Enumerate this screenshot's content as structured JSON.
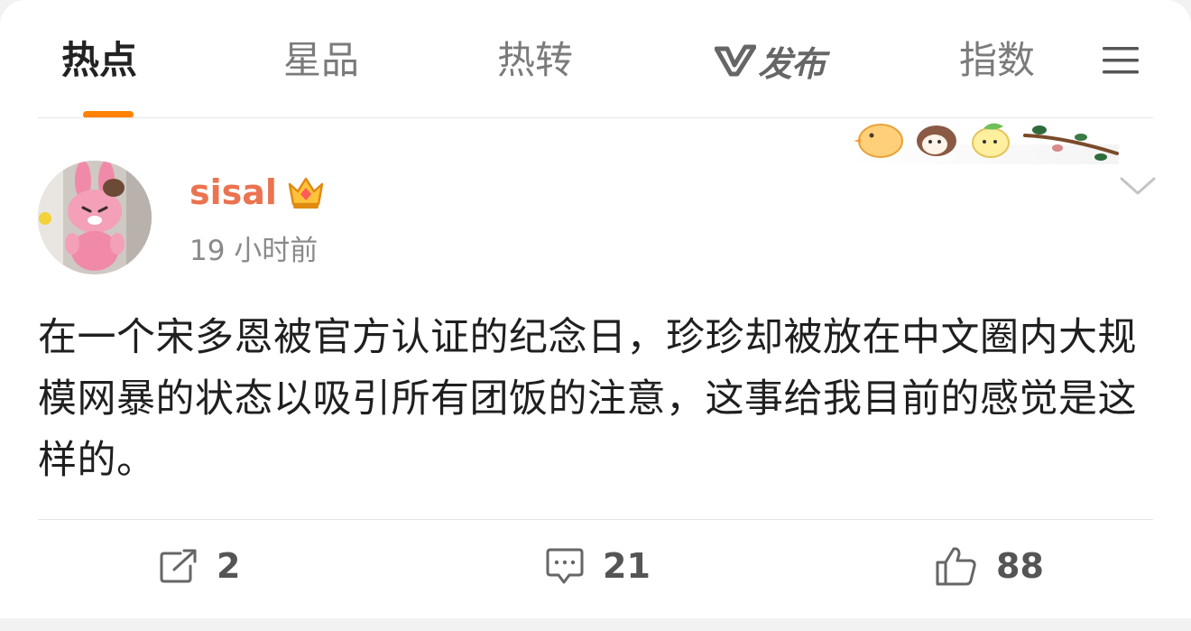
{
  "tabs": [
    {
      "label": "热点",
      "active": true
    },
    {
      "label": "星品",
      "active": false
    },
    {
      "label": "热转",
      "active": false
    },
    {
      "label": "发布",
      "active": false
    },
    {
      "label": "指数",
      "active": false
    }
  ],
  "icons": {
    "menu": "hamburger-menu-icon",
    "vpublish": "v-logo-icon",
    "crown": "crown-icon",
    "more": "chevron-down-icon",
    "repost": "repost-icon",
    "comment": "comment-icon",
    "like": "thumbs-up-icon"
  },
  "colors": {
    "accent": "#ff8200",
    "username": "#eb7350",
    "text": "#1f1f1f",
    "muted": "#8a8a8a"
  },
  "post": {
    "username": "sisal",
    "timestamp": "19 小时前",
    "text": "在一个宋多恩被官方认证的纪念日，珍珍却被放在中文圈内大规模网暴的状态以吸引所有团饭的注意，这事给我目前的感觉是这样的。"
  },
  "actions": {
    "repost_count": "2",
    "comment_count": "21",
    "like_count": "88"
  }
}
